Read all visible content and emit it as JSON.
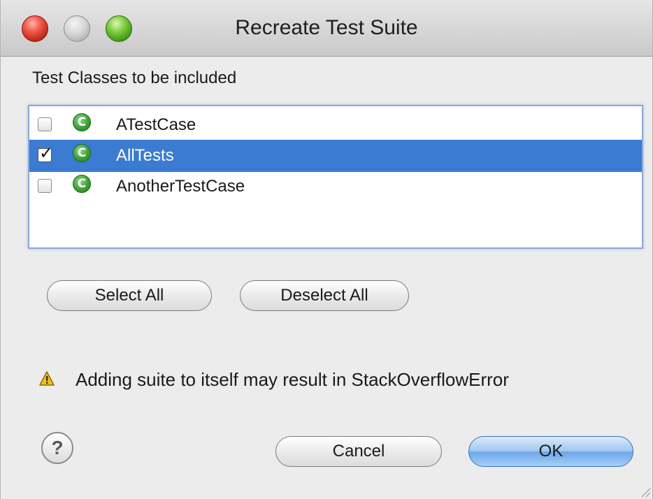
{
  "window": {
    "title": "Recreate Test Suite"
  },
  "section_label": "Test Classes to be included",
  "classes": [
    {
      "label": "ATestCase",
      "checked": false,
      "selected": false,
      "icon": "class-icon",
      "icon_glyph": "C"
    },
    {
      "label": "AllTests",
      "checked": true,
      "selected": true,
      "icon": "class-icon",
      "icon_glyph": "C"
    },
    {
      "label": "AnotherTestCase",
      "checked": false,
      "selected": false,
      "icon": "class-icon",
      "icon_glyph": "C"
    }
  ],
  "buttons": {
    "select_all": "Select All",
    "deselect_all": "Deselect All",
    "cancel": "Cancel",
    "ok": "OK"
  },
  "warning": {
    "icon": "warning-icon",
    "text": "Adding suite to itself may result in StackOverflowError"
  },
  "help": {
    "icon": "help-icon",
    "glyph": "?"
  },
  "colors": {
    "selection": "#3b7bd1",
    "class_icon": "#3da136",
    "default_button": "#6aa6e6"
  }
}
